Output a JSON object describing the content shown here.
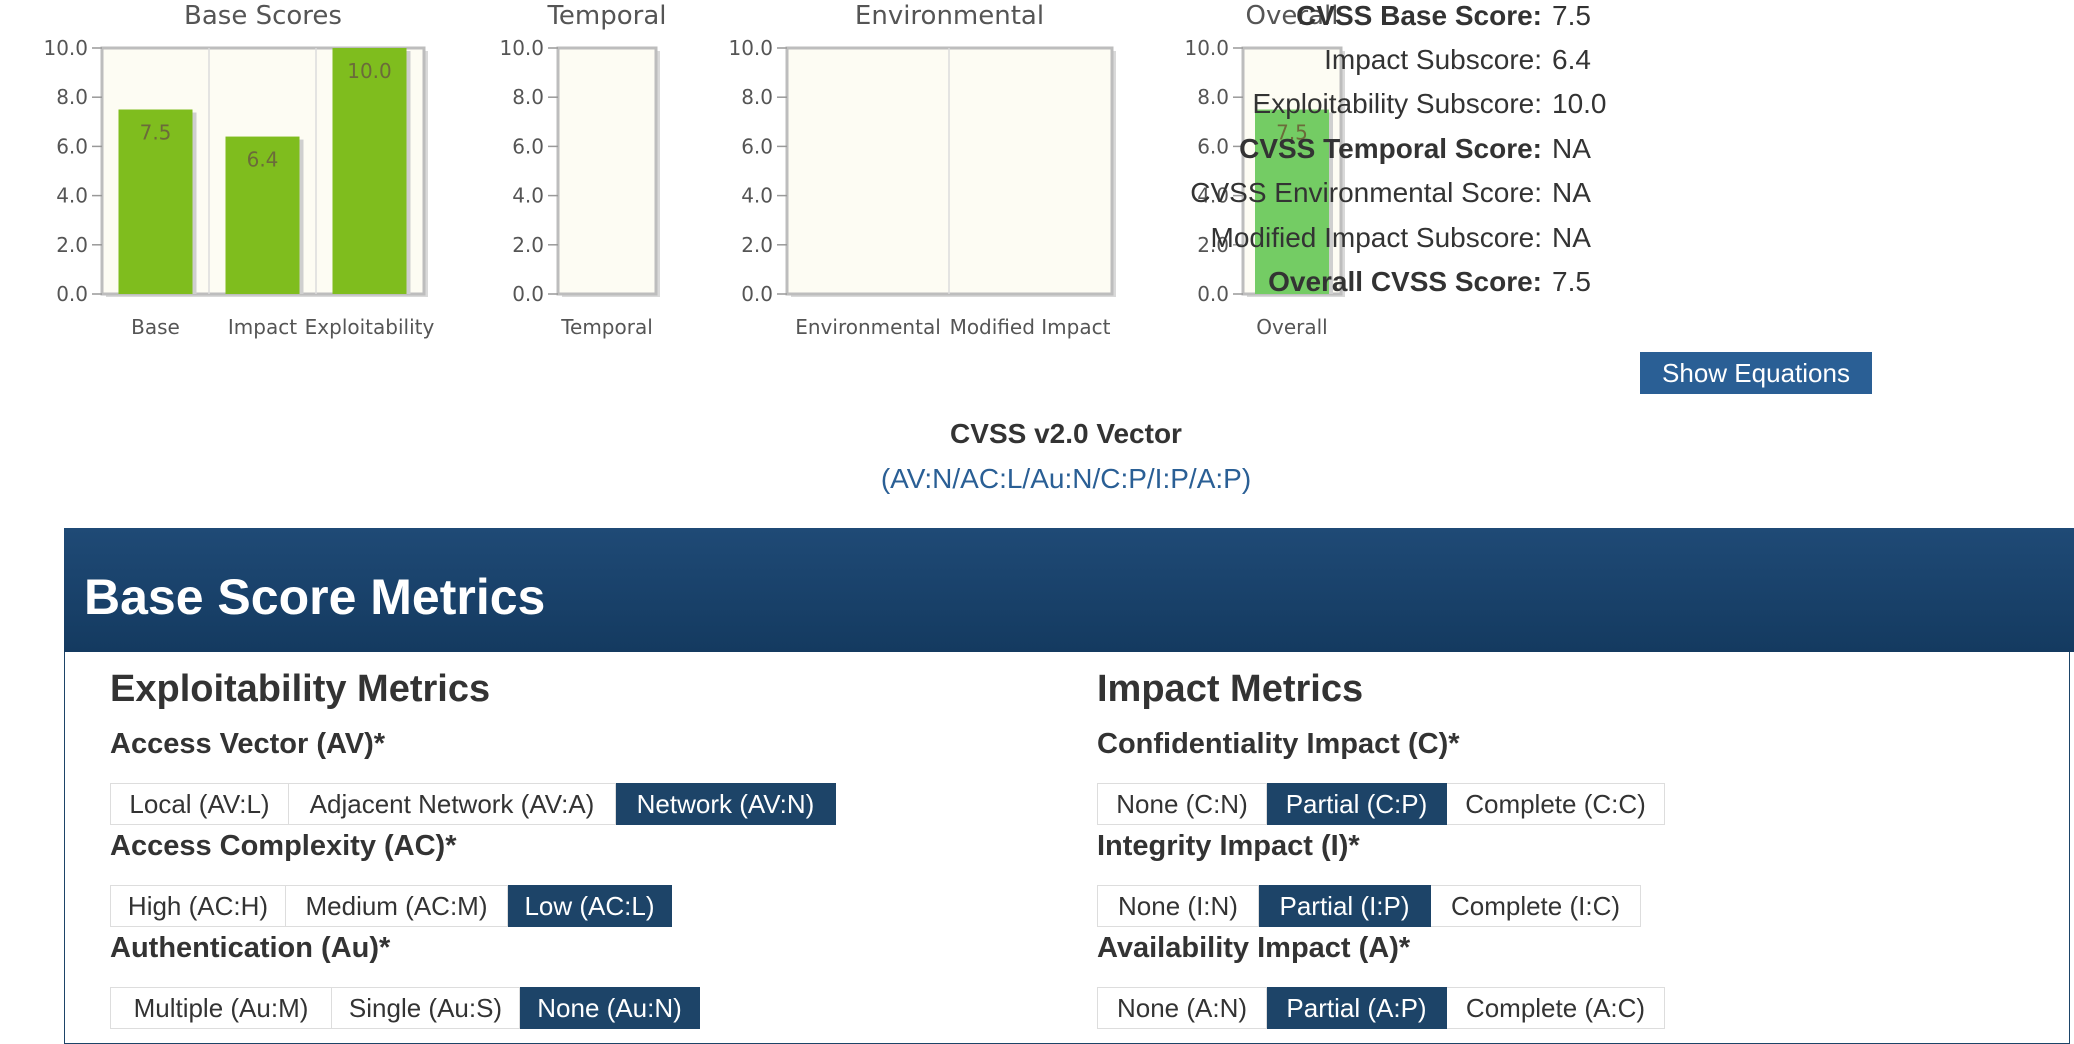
{
  "chart_data": [
    {
      "type": "bar",
      "title": "Base Scores",
      "categories": [
        "Base",
        "Impact",
        "Exploitability"
      ],
      "values": [
        7.5,
        6.4,
        10.0
      ],
      "value_labels": [
        "7.5",
        "6.4",
        "10.0"
      ],
      "ylim": [
        0,
        10
      ],
      "yticks": [
        "0.0",
        "2.0",
        "4.0",
        "6.0",
        "8.0",
        "10.0"
      ],
      "grid": true,
      "bar_color": "#7fbd1e"
    },
    {
      "type": "bar",
      "title": "Temporal",
      "categories": [
        "Temporal"
      ],
      "values": [
        null
      ],
      "value_labels": [
        ""
      ],
      "ylim": [
        0,
        10
      ],
      "yticks": [
        "0.0",
        "2.0",
        "4.0",
        "6.0",
        "8.0",
        "10.0"
      ],
      "grid": true,
      "bar_color": "#7fbd1e"
    },
    {
      "type": "bar",
      "title": "Environmental",
      "categories": [
        "Environmental",
        "Modified Impact"
      ],
      "values": [
        null,
        null
      ],
      "value_labels": [
        "",
        ""
      ],
      "ylim": [
        0,
        10
      ],
      "yticks": [
        "0.0",
        "2.0",
        "4.0",
        "6.0",
        "8.0",
        "10.0"
      ],
      "grid": true,
      "bar_color": "#7fbd1e"
    },
    {
      "type": "bar",
      "title": "Overall",
      "categories": [
        "Overall"
      ],
      "values": [
        7.5
      ],
      "value_labels": [
        "7.5"
      ],
      "ylim": [
        0,
        10
      ],
      "yticks": [
        "0.0",
        "2.0",
        "4.0",
        "6.0",
        "8.0",
        "10.0"
      ],
      "grid": true,
      "bar_color": "#74cc64"
    }
  ],
  "scores": [
    {
      "label": "CVSS Base Score:",
      "value": "7.5",
      "bold": true
    },
    {
      "label": "Impact Subscore:",
      "value": "6.4",
      "bold": false
    },
    {
      "label": "Exploitability Subscore:",
      "value": "10.0",
      "bold": false
    },
    {
      "label": "CVSS Temporal Score:",
      "value": "NA",
      "bold": true
    },
    {
      "label": "CVSS Environmental Score:",
      "value": "NA",
      "bold": false
    },
    {
      "label": "Modified Impact Subscore:",
      "value": "NA",
      "bold": false
    },
    {
      "label": "Overall CVSS Score:",
      "value": "7.5",
      "bold": true
    }
  ],
  "show_equations_label": "Show Equations",
  "vector": {
    "heading": "CVSS v2.0 Vector",
    "value": "(AV:N/AC:L/Au:N/C:P/I:P/A:P)"
  },
  "metrics_panel": {
    "title": "Base Score Metrics",
    "exploitability": {
      "title": "Exploitability Metrics",
      "metrics": [
        {
          "name": "Access Vector (AV)*",
          "options": [
            "Local (AV:L)",
            "Adjacent Network (AV:A)",
            "Network (AV:N)"
          ],
          "selected": "Network (AV:N)"
        },
        {
          "name": "Access Complexity (AC)*",
          "options": [
            "High (AC:H)",
            "Medium (AC:M)",
            "Low (AC:L)"
          ],
          "selected": "Low (AC:L)"
        },
        {
          "name": "Authentication (Au)*",
          "options": [
            "Multiple (Au:M)",
            "Single (Au:S)",
            "None (Au:N)"
          ],
          "selected": "None (Au:N)"
        }
      ]
    },
    "impact": {
      "title": "Impact Metrics",
      "metrics": [
        {
          "name": "Confidentiality Impact (C)*",
          "options": [
            "None (C:N)",
            "Partial (C:P)",
            "Complete (C:C)"
          ],
          "selected": "Partial (C:P)"
        },
        {
          "name": "Integrity Impact (I)*",
          "options": [
            "None (I:N)",
            "Partial (I:P)",
            "Complete (I:C)"
          ],
          "selected": "Partial (I:P)"
        },
        {
          "name": "Availability Impact (A)*",
          "options": [
            "None (A:N)",
            "Partial (A:P)",
            "Complete (A:C)"
          ],
          "selected": "Partial (A:P)"
        }
      ]
    }
  },
  "colors": {
    "accent": "#2a5f95",
    "header": "#1d4468",
    "plot_bg": "#fdfcf3"
  }
}
